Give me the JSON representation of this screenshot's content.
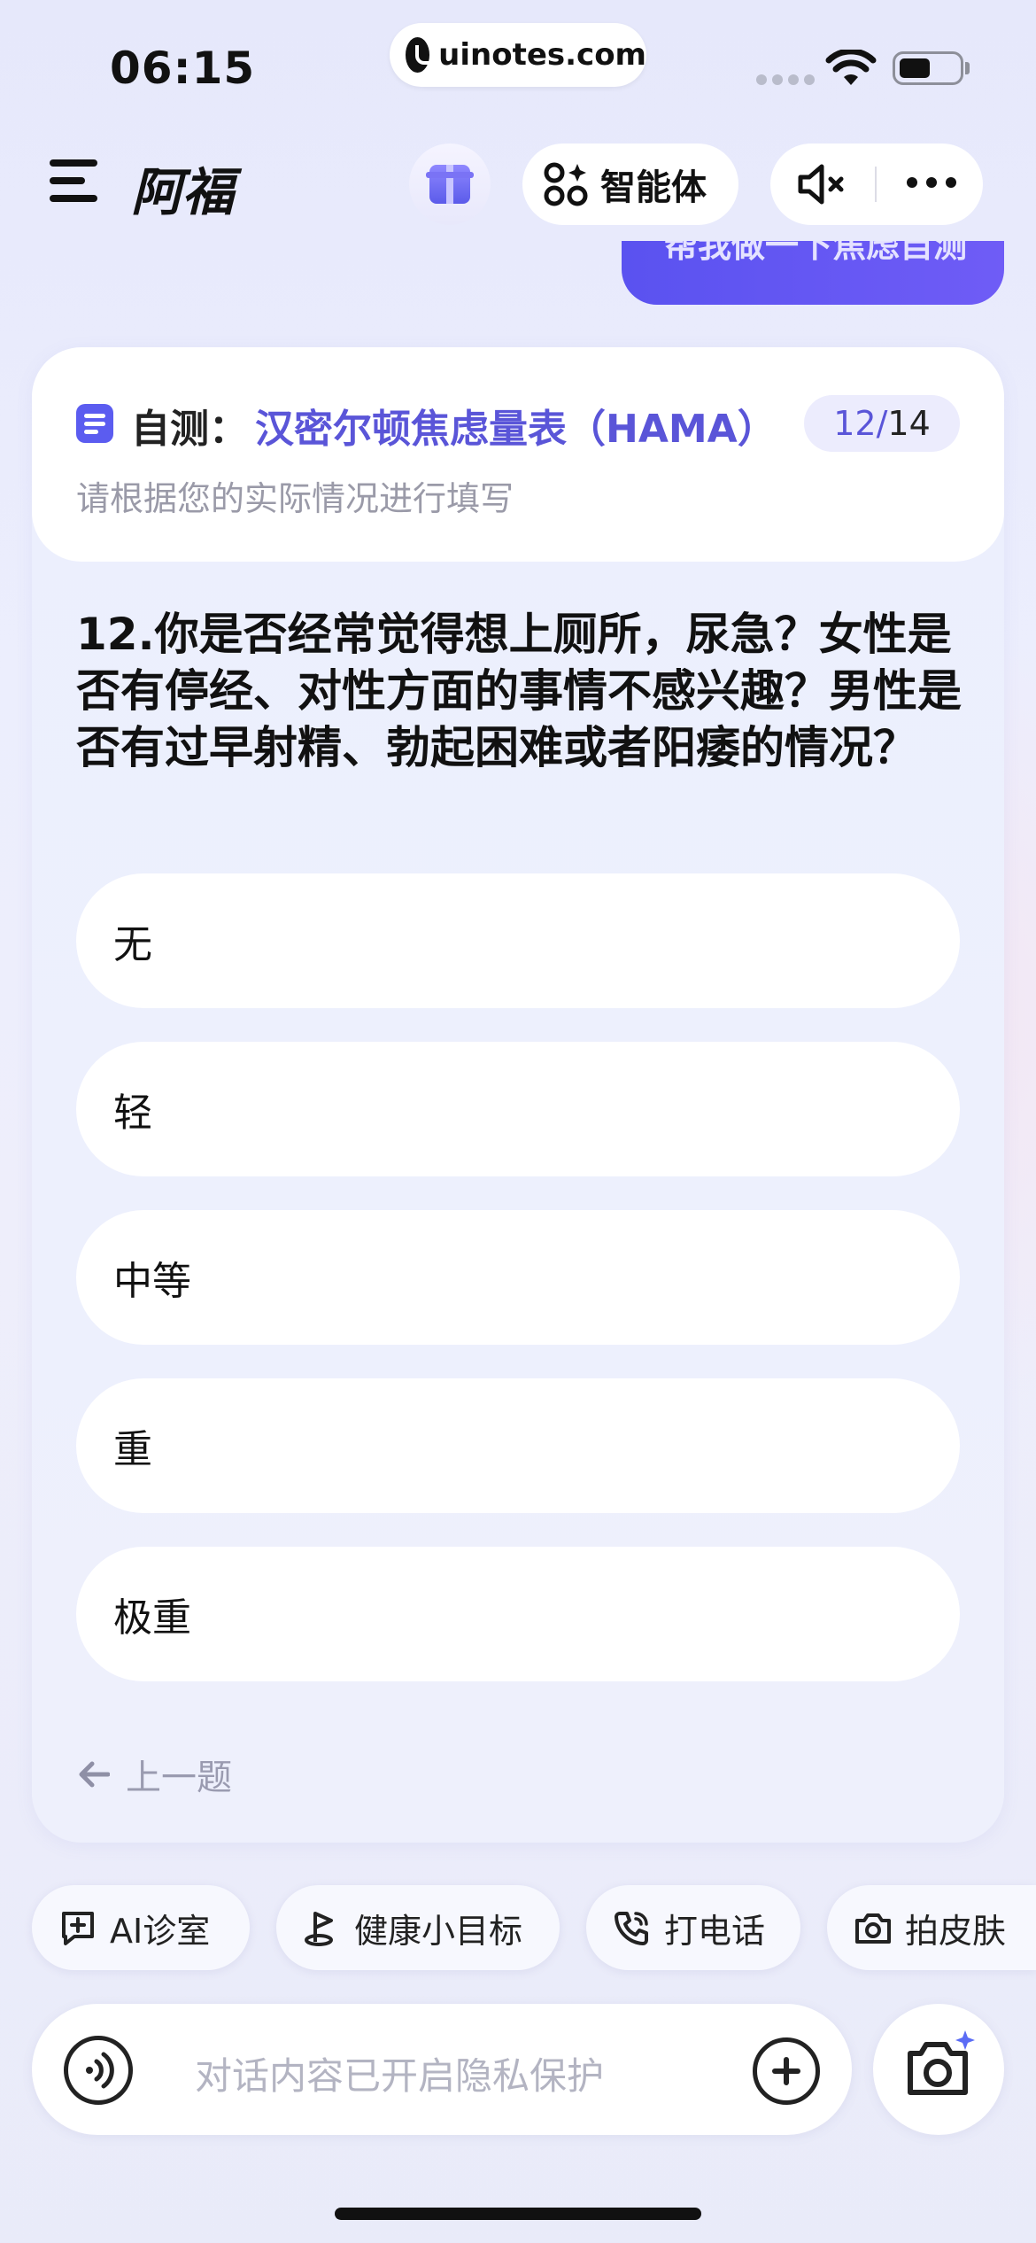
{
  "status": {
    "time": "06:15",
    "url": "uinotes.com"
  },
  "header": {
    "title": "阿福",
    "agent_label": "智能体"
  },
  "chat": {
    "user_bubble_text": "帮我做一下焦虑自测"
  },
  "survey": {
    "prefix": "自测：",
    "name": "汉密尔顿焦虑量表（HAMA）",
    "progress_current": "12",
    "progress_sep": "/",
    "progress_total": "14",
    "subtitle": "请根据您的实际情况进行填写",
    "question": "12.你是否经常觉得想上厕所，尿急？女性是否有停经、对性方面的事情不感兴趣？男性是否有过早射精、勃起困难或者阳痿的情况？",
    "options": [
      "无",
      "轻",
      "中等",
      "重",
      "极重"
    ],
    "prev_label": "上一题"
  },
  "quick_actions": [
    "AI诊室",
    "健康小目标",
    "打电话",
    "拍皮肤"
  ],
  "input": {
    "placeholder": "对话内容已开启隐私保护"
  },
  "colors": {
    "accent": "#5a55d8",
    "bubble": "#5a52f0"
  }
}
